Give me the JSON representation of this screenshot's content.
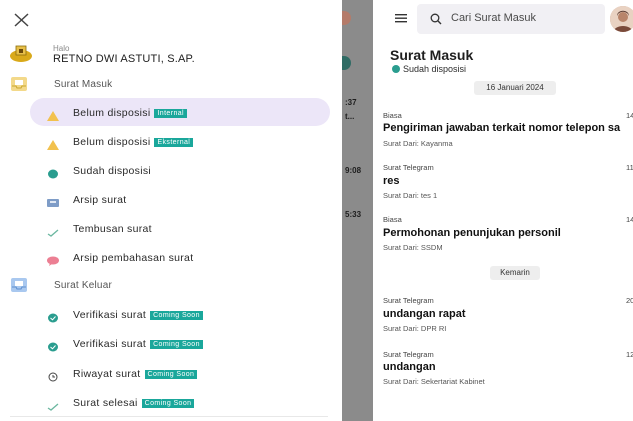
{
  "drawer": {
    "greeting": "Halo",
    "user_name": "RETNO DWI ASTUTI, S.AP.",
    "sections": [
      {
        "label": "Surat Masuk",
        "items": [
          {
            "label": "Belum disposisi",
            "badge": "Internal",
            "icon": "warning-triangle-icon",
            "icon_color": "#f2c14e",
            "active": true
          },
          {
            "label": "Belum disposisi",
            "badge": "Eksternal",
            "icon": "warning-triangle-icon",
            "icon_color": "#f2c14e"
          },
          {
            "label": "Sudah disposisi",
            "badge": "",
            "icon": "check-circle-icon",
            "icon_color": "#2a9d8f"
          },
          {
            "label": "Arsip surat",
            "badge": "",
            "icon": "archive-icon",
            "icon_color": "#7e9cc7"
          },
          {
            "label": "Tembusan surat",
            "badge": "",
            "icon": "checkmark-icon",
            "icon_color": "#6bb7a0"
          },
          {
            "label": "Arsip pembahasan surat",
            "badge": "",
            "icon": "chat-bubble-icon",
            "icon_color": "#ec7f93"
          }
        ]
      },
      {
        "label": "Surat Keluar",
        "items": [
          {
            "label": "Verifikasi surat",
            "badge": "Coming Soon",
            "icon": "verified-icon",
            "icon_color": "#2a9d8f"
          },
          {
            "label": "Verifikasi surat",
            "badge": "Coming Soon",
            "icon": "verified-icon",
            "icon_color": "#2a9d8f"
          },
          {
            "label": "Riwayat surat",
            "badge": "Coming Soon",
            "icon": "history-icon",
            "icon_color": "#444444"
          },
          {
            "label": "Surat selesai",
            "badge": "Coming Soon",
            "icon": "checkmark-icon",
            "icon_color": "#6bb7a0"
          }
        ]
      }
    ]
  },
  "background_strip": {
    "times": [
      ":37",
      "t...",
      "9:08",
      "5:33"
    ]
  },
  "app": {
    "search_placeholder": "Cari Surat Masuk",
    "page_title": "Surat Masuk",
    "status": "Sudah disposisi",
    "groups": [
      {
        "date": "16 Januari 2024",
        "messages": [
          {
            "type": "Biasa",
            "time": "14",
            "subject": "Pengiriman jawaban terkait nomor telepon sa",
            "from": "Surat Dari: Kayanma"
          },
          {
            "type": "Surat Telegram",
            "time": "11",
            "subject": "res",
            "from": "Surat Dari: tes 1"
          },
          {
            "type": "Biasa",
            "time": "14",
            "subject": "Permohonan penunjukan personil",
            "from": "Surat Dari: SSDM"
          }
        ]
      },
      {
        "date": "Kemarin",
        "messages": [
          {
            "type": "Surat Telegram",
            "time": "20",
            "subject": "undangan rapat",
            "from": "Surat Dari: DPR RI"
          },
          {
            "type": "Surat Telegram",
            "time": "12",
            "subject": "undangan",
            "from": "Surat Dari: Sekertariat Kabinet"
          }
        ]
      }
    ]
  },
  "colors": {
    "accent_teal": "#1aa79b",
    "active_highlight": "#ece6f8",
    "overlay_grey": "#8b8b8b"
  }
}
